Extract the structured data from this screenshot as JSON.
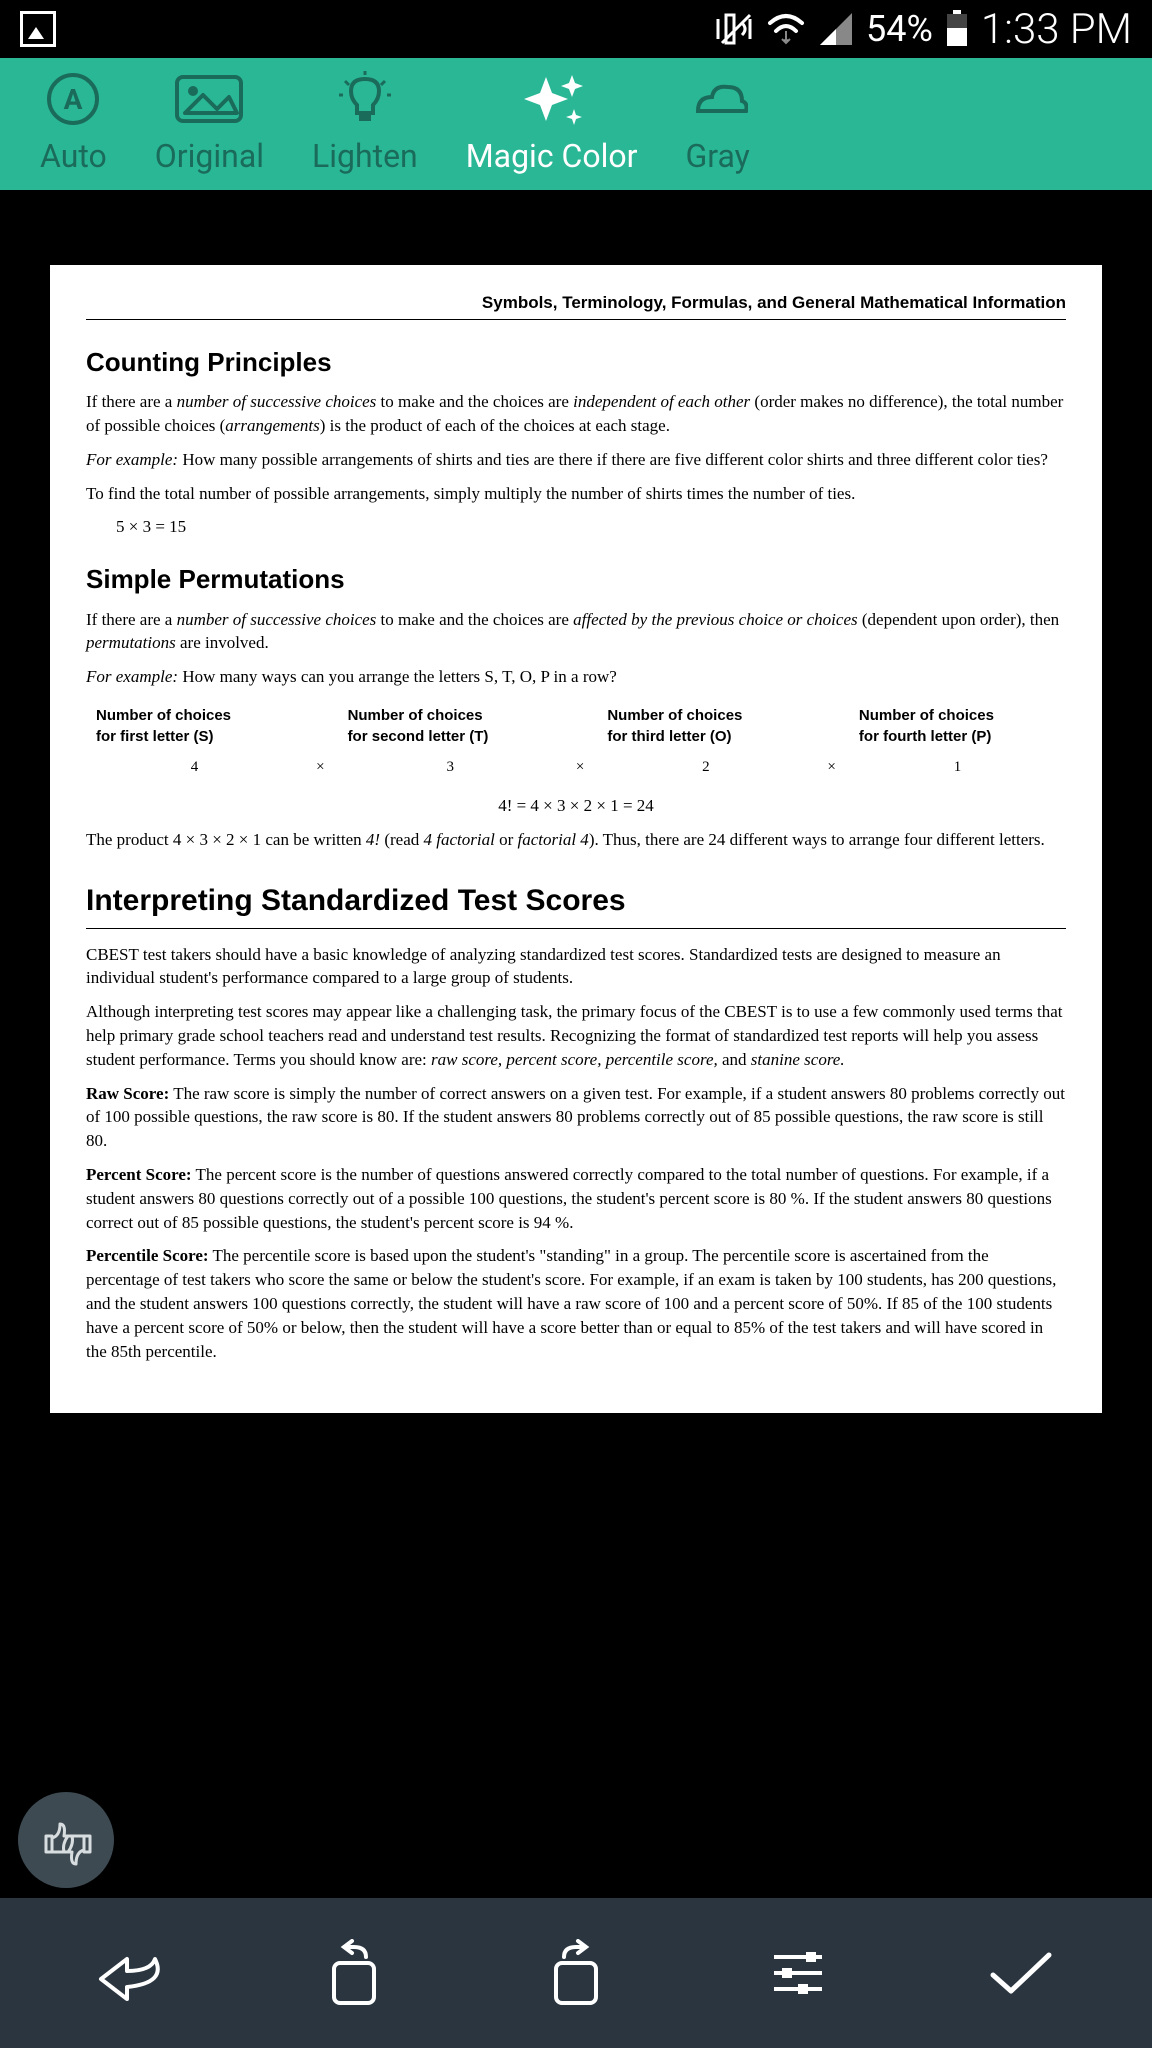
{
  "status": {
    "battery_pct": "54%",
    "time": "1:33 PM"
  },
  "filters": {
    "auto": "Auto",
    "original": "Original",
    "lighten": "Lighten",
    "magic_color": "Magic Color",
    "gray": "Gray"
  },
  "doc": {
    "header": "Symbols, Terminology, Formulas, and General Mathematical Information",
    "s1_title": "Counting Principles",
    "s1_p1a": "If there are a ",
    "s1_p1b": "number of successive choices",
    "s1_p1c": " to make and the choices are ",
    "s1_p1d": "independent of each other",
    "s1_p1e": " (order makes no difference), the total number of possible choices (",
    "s1_p1f": "arrangements",
    "s1_p1g": ") is the product of each of the choices at each stage.",
    "s1_ex_label": "For example:",
    "s1_ex_text": " How many possible arrangements of shirts and ties are there if there are five different color shirts and three different color ties?",
    "s1_p2": "To find the total number of possible arrangements, simply multiply the number of shirts times the number of ties.",
    "s1_eq": "5 × 3 = 15",
    "s2_title": "Simple Permutations",
    "s2_p1a": "If there are a ",
    "s2_p1b": "number of successive choices",
    "s2_p1c": " to make and the choices are ",
    "s2_p1d": "affected by the previous choice or choices",
    "s2_p1e": " (dependent upon order), then ",
    "s2_p1f": "permutations",
    "s2_p1g": " are involved.",
    "s2_ex_text": " How many ways can you arrange the letters S, T, O, P in a row?",
    "perm_h1a": "Number of choices",
    "perm_h1b": "for first letter (S)",
    "perm_h2a": "Number of choices",
    "perm_h2b": "for second letter (T)",
    "perm_h3a": "Number of choices",
    "perm_h3b": "for third letter (O)",
    "perm_h4a": "Number of choices",
    "perm_h4b": "for fourth letter (P)",
    "perm_v1": "4",
    "perm_v2": "3",
    "perm_v3": "2",
    "perm_v4": "1",
    "perm_x": "×",
    "s2_eq": "4! = 4 × 3 × 2 × 1 = 24",
    "s2_p2a": "The product 4 × 3 × 2 × 1 can be written ",
    "s2_p2b": "4!",
    "s2_p2c": " (read ",
    "s2_p2d": "4 factorial",
    "s2_p2e": " or ",
    "s2_p2f": "factorial 4",
    "s2_p2g": "). Thus, there are 24 different ways to arrange four different letters.",
    "s3_title": "Interpreting Standardized Test Scores",
    "s3_p1": "CBEST test takers should have a basic knowledge of analyzing standardized test scores. Standardized tests are designed to measure an individual student's performance compared to a large group of students.",
    "s3_p2a": "Although interpreting test scores may appear like a challenging task, the primary focus of the CBEST is to use a few commonly used terms that help primary grade school teachers read and understand test results. Recognizing the format of standardized test reports will help you assess student performance. Terms you should know are: ",
    "s3_p2b": "raw score, percent score, percentile score,",
    "s3_p2c": " and ",
    "s3_p2d": "stanine score.",
    "raw_label": "Raw Score:",
    "raw_text": " The raw score is simply the number of correct answers on a given test. For example, if a student answers 80 problems correctly out of 100 possible questions, the raw score is 80. If the student answers 80 problems correctly out of 85 possible questions, the raw score is still 80.",
    "pct_label": "Percent Score:",
    "pct_text": " The percent score is the number of questions answered correctly compared to the total number of questions. For example, if a student answers 80 questions correctly out of a possible 100 questions, the student's percent score is 80 %. If the student answers 80 questions correct out of 85 possible questions, the student's percent score is 94 %.",
    "pile_label": "Percentile Score:",
    "pile_text": " The percentile score is based upon the student's \"standing\" in a group. The percentile score is ascertained from the percentage of test takers who score the same or below the student's score. For example, if an exam is taken by 100 students, has 200 questions, and the student answers 100 questions correctly, the student will have a raw score of 100 and a percent score of 50%. If 85 of the 100 students have a percent score of 50% or below, then the student will have a score better than or equal to 85% of the test takers and will have scored in the 85th percentile."
  }
}
